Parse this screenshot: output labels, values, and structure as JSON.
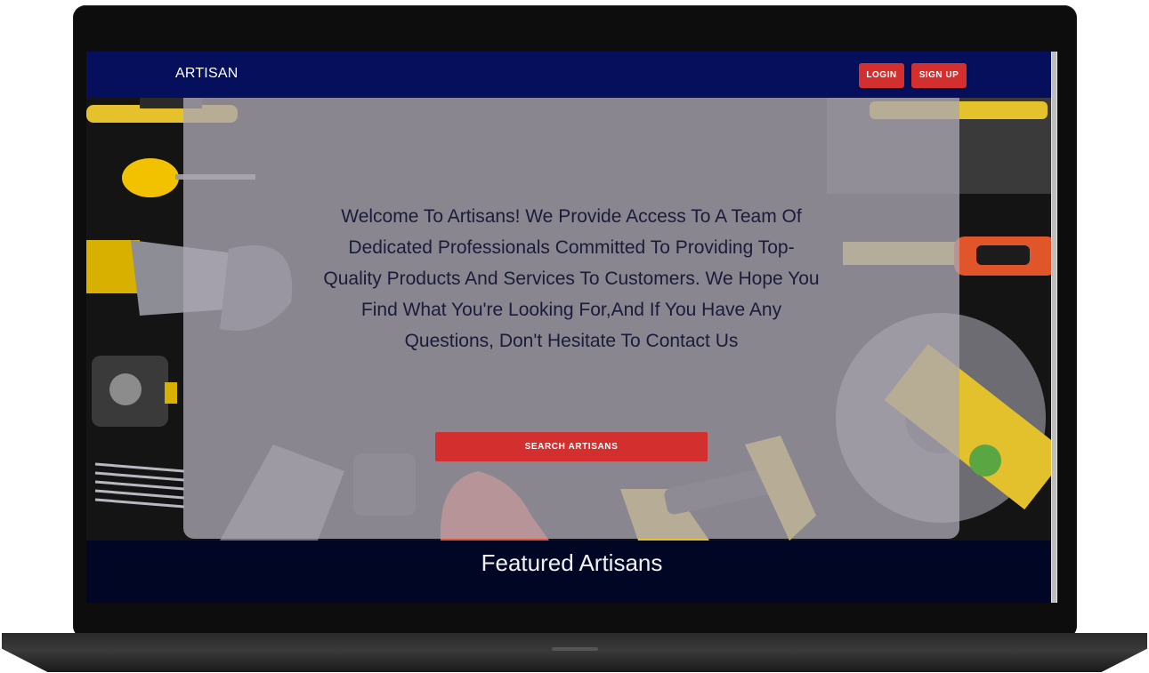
{
  "nav": {
    "brand": "ARTISAN",
    "login_label": "LOGIN",
    "signup_label": "SIGN UP"
  },
  "hero": {
    "message": "Welcome To Artisans! We Provide Access To A Team Of Dedicated Professionals Committed To Providing Top-Quality Products And Services To Customers. We Hope You Find What You're Looking For,And If You Have Any Questions, Don't Hesitate To Contact Us",
    "search_button_label": "SEARCH ARTISANS"
  },
  "featured": {
    "title": "Featured Artisans"
  },
  "colors": {
    "navbar": "#050f5c",
    "accent_button": "#d32f2f",
    "footer_bg": "#000624",
    "overlay": "#aaa6b2"
  }
}
